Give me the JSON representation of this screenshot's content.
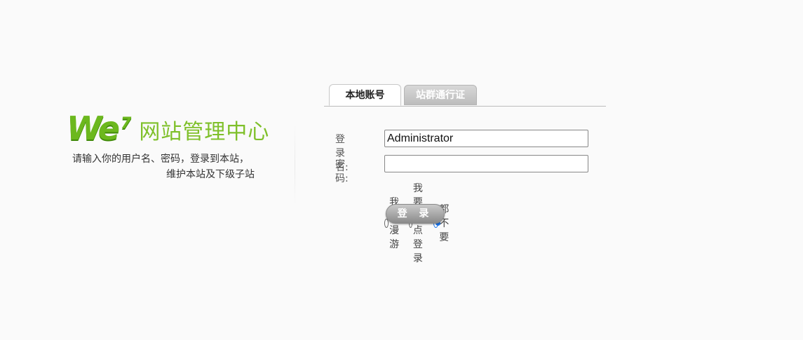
{
  "logo": {
    "brand_text": "We",
    "brand_sup": "7",
    "title": "网站管理中心",
    "desc_line1": "请输入你的用户名、密码，登录到本站，",
    "desc_line2": "维护本站及下级子站",
    "brand_color": "#6cb81e"
  },
  "tabs": [
    {
      "label": "本地账号",
      "active": true
    },
    {
      "label": "站群通行证",
      "active": false
    }
  ],
  "form": {
    "username_label": "登录名:",
    "username_value": "Administrator",
    "password_label": "密 码:",
    "password_value": "",
    "options": [
      {
        "label": "我要漫游",
        "checked": false
      },
      {
        "label": "我要单点登录",
        "checked": false
      },
      {
        "label": "都不要",
        "checked": true
      }
    ],
    "login_button": "登 录"
  }
}
